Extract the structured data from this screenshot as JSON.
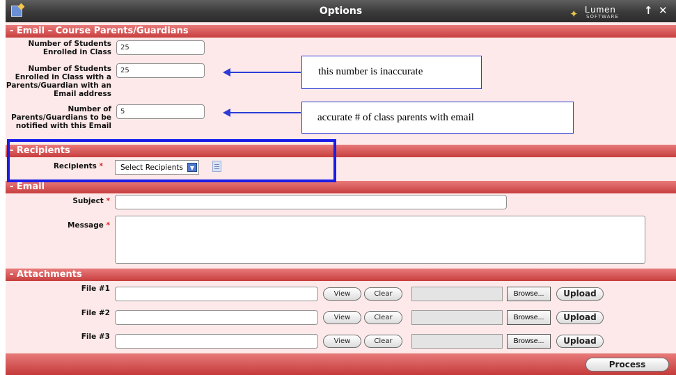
{
  "window": {
    "title": "Options",
    "logo_name": "Lumen",
    "logo_sub": "SOFTWARE",
    "pin_glyph": "↑",
    "close_glyph": "✕"
  },
  "sections": {
    "email_parents": "- Email – Course Parents/Guardians",
    "recipients": "- Recipients",
    "email": "- Email",
    "attachments": "- Attachments"
  },
  "stats": [
    {
      "label": "Number of Students Enrolled in Class",
      "value": "25"
    },
    {
      "label": "Number of Students Enrolled in Class with a Parents/Guardian with an Email address",
      "value": "25"
    },
    {
      "label": "Number of Parents/Guardians to be notified with this Email",
      "value": "5"
    }
  ],
  "recipients": {
    "label": "Recipients",
    "required_mark": "*",
    "selected": "Select Recipients"
  },
  "email": {
    "subject_label": "Subject",
    "message_label": "Message",
    "required_mark": "*",
    "subject_value": "",
    "message_value": ""
  },
  "attachments": {
    "files": [
      {
        "label": "File #1"
      },
      {
        "label": "File #2"
      },
      {
        "label": "File #3"
      }
    ],
    "view_label": "View",
    "clear_label": "Clear",
    "browse_label": "Browse...",
    "upload_label": "Upload"
  },
  "footer": {
    "process_label": "Process"
  },
  "annotations": {
    "callout1": "this number is inaccurate",
    "callout2": "accurate # of class parents with email",
    "annotation_color": "#2c3bd6",
    "highlight_color": "#1a1de6"
  },
  "icons": [
    "document-icon",
    "lumen-logo-icon",
    "pin-icon",
    "close-icon",
    "dropdown-arrow-icon",
    "notes-icon"
  ]
}
